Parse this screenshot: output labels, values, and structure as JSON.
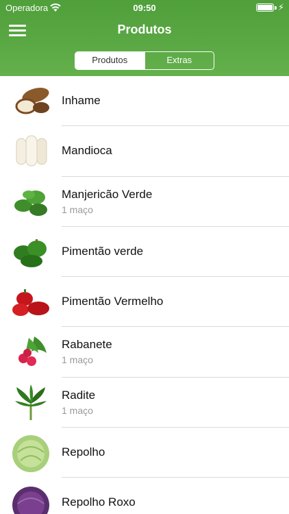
{
  "status_bar": {
    "carrier": "Operadora",
    "time": "09:50"
  },
  "nav": {
    "title": "Produtos"
  },
  "tabs": [
    {
      "label": "Produtos",
      "active": true
    },
    {
      "label": "Extras",
      "active": false
    }
  ],
  "products": [
    {
      "name": "Inhame",
      "subtitle": "",
      "icon": "yam-image"
    },
    {
      "name": "Mandioca",
      "subtitle": "",
      "icon": "cassava-image"
    },
    {
      "name": "Manjericão Verde",
      "subtitle": "1 maço",
      "icon": "basil-image"
    },
    {
      "name": "Pimentão verde",
      "subtitle": "",
      "icon": "green-pepper-image"
    },
    {
      "name": "Pimentão Vermelho",
      "subtitle": "",
      "icon": "red-pepper-image"
    },
    {
      "name": "Rabanete",
      "subtitle": "1 maço",
      "icon": "radish-image"
    },
    {
      "name": "Radite",
      "subtitle": "1 maço",
      "icon": "chicory-image"
    },
    {
      "name": "Repolho",
      "subtitle": "",
      "icon": "cabbage-image"
    },
    {
      "name": "Repolho Roxo",
      "subtitle": "",
      "icon": "red-cabbage-image"
    }
  ],
  "colors": {
    "header_green": "#5aa844",
    "divider": "#d9d9d9",
    "subtitle": "#999999"
  }
}
